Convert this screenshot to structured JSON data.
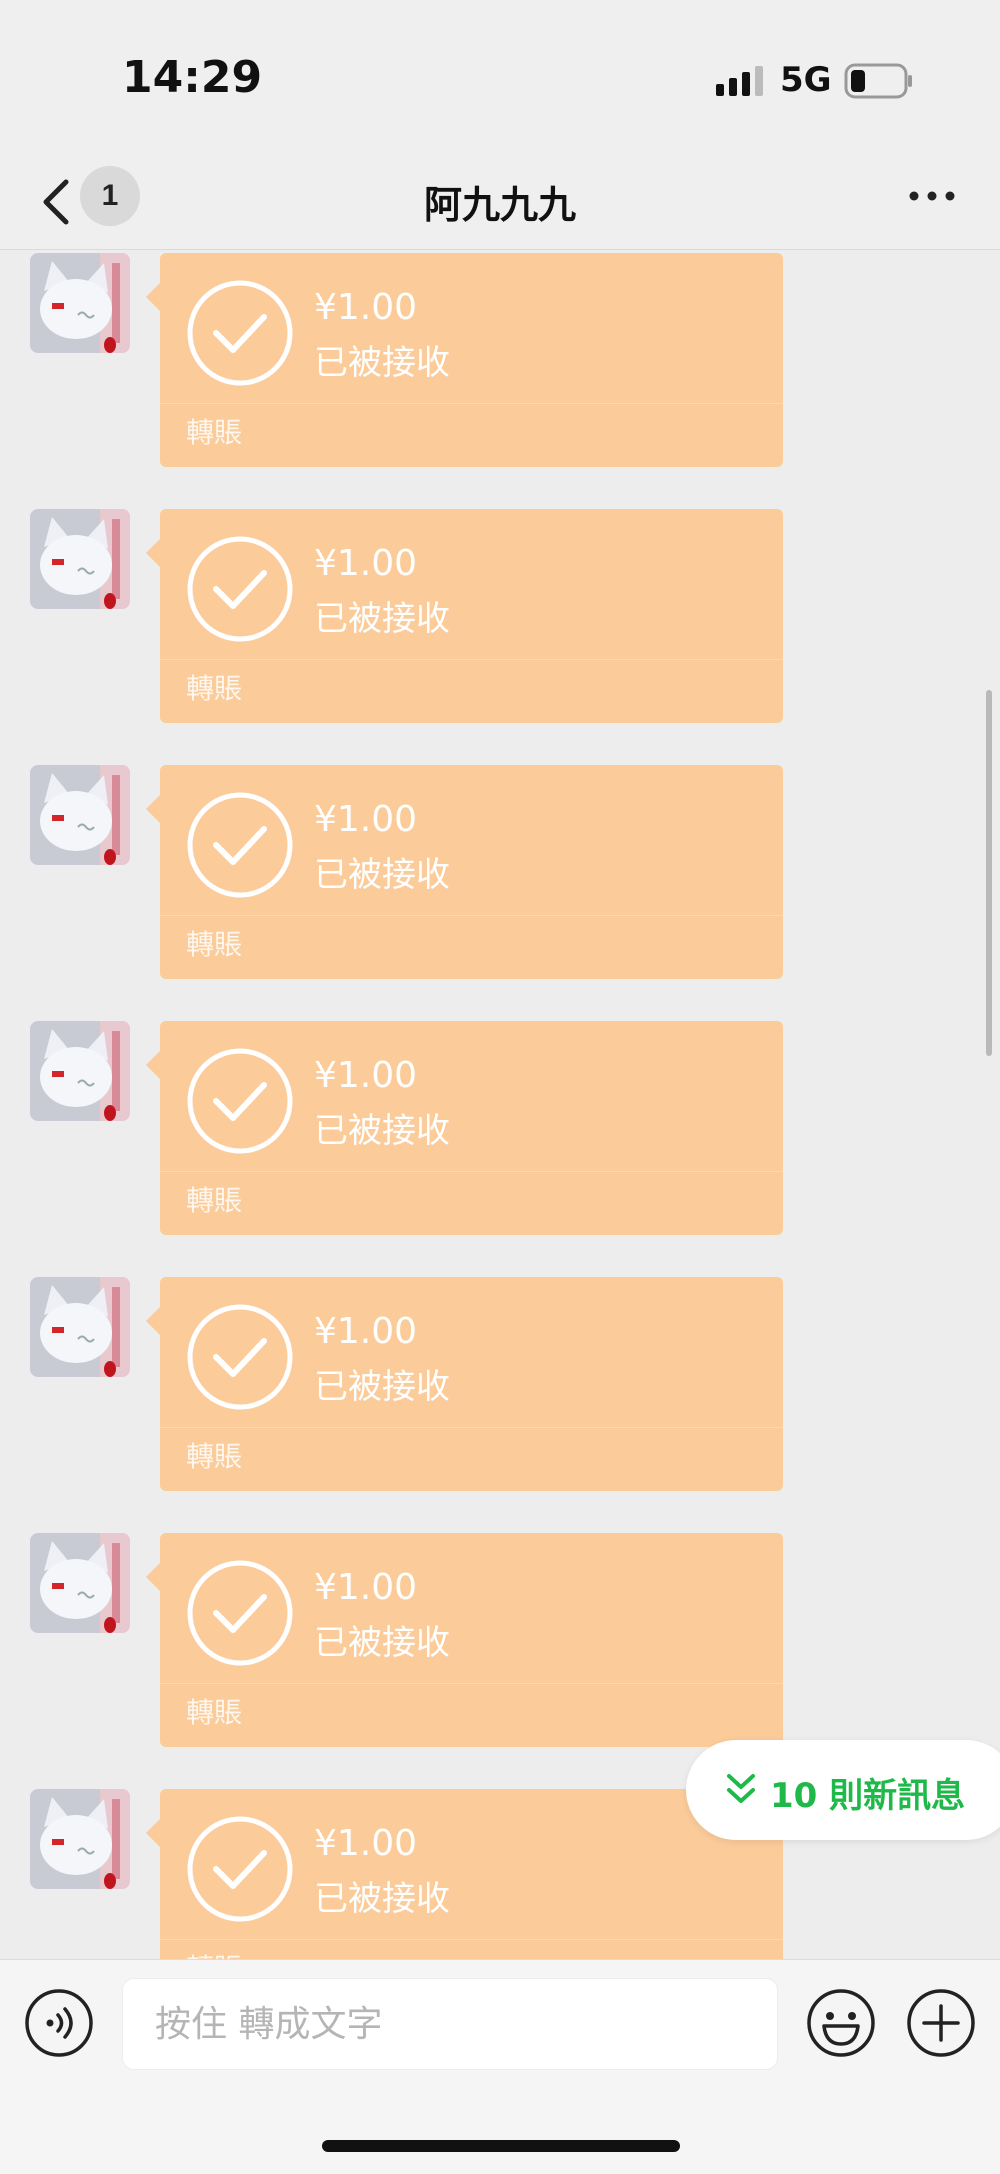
{
  "status_bar": {
    "time": "14:29",
    "network": "5G"
  },
  "nav": {
    "unread_count": "1",
    "title": "阿九九九"
  },
  "messages": [
    {
      "amount": "¥1.00",
      "status": "已被接收",
      "label": "轉賬"
    },
    {
      "amount": "¥1.00",
      "status": "已被接收",
      "label": "轉賬"
    },
    {
      "amount": "¥1.00",
      "status": "已被接收",
      "label": "轉賬"
    },
    {
      "amount": "¥1.00",
      "status": "已被接收",
      "label": "轉賬"
    },
    {
      "amount": "¥1.00",
      "status": "已被接收",
      "label": "轉賬"
    },
    {
      "amount": "¥1.00",
      "status": "已被接收",
      "label": "轉賬"
    },
    {
      "amount": "¥1.00",
      "status": "已被接收",
      "label": "轉賬"
    }
  ],
  "new_messages_pill": {
    "text": "10 則新訊息"
  },
  "input_bar": {
    "placeholder": "按住 轉成文字"
  },
  "colors": {
    "transfer_card": "#fbcb9a",
    "accent_green": "#1fb94a"
  }
}
